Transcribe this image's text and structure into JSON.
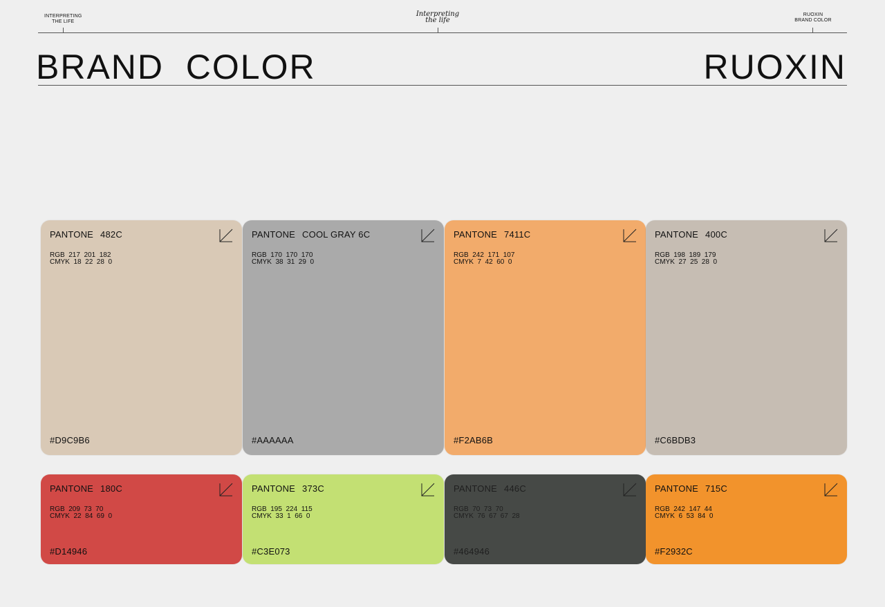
{
  "header": {
    "left_line1": "INTERPRETING",
    "left_line2": "THE LIFE",
    "center_line1": "Interpreting",
    "center_line2": "the life",
    "right_line1": "RUOXIN",
    "right_line2": "BRAND COLOR"
  },
  "title": {
    "left": "BRAND  COLOR",
    "right": "RUOXIN"
  },
  "swatches": [
    {
      "label": "PANTONE",
      "code": "482C",
      "rgb": "RGB  217  201  182",
      "cmyk": "CMYK  18  22  28  0",
      "hex": "#D9C9B6",
      "color": "#D9C9B6"
    },
    {
      "label": "PANTONE",
      "code": "COOL GRAY 6C",
      "rgb": "RGB  170  170  170",
      "cmyk": "CMYK  38  31  29  0",
      "hex": "#AAAAAA",
      "color": "#AAAAAA"
    },
    {
      "label": "PANTONE",
      "code": "7411C",
      "rgb": "RGB  242  171  107",
      "cmyk": "CMYK  7  42  60  0",
      "hex": "#F2AB6B",
      "color": "#F2AB6B"
    },
    {
      "label": "PANTONE",
      "code": "400C",
      "rgb": "RGB  198  189  179",
      "cmyk": "CMYK  27  25  28  0",
      "hex": "#C6BDB3",
      "color": "#C6BDB3"
    },
    {
      "label": "PANTONE",
      "code": "180C",
      "rgb": "RGB  209  73  70",
      "cmyk": "CMYK  22  84  69  0",
      "hex": "#D14946",
      "color": "#D14946"
    },
    {
      "label": "PANTONE",
      "code": "373C",
      "rgb": "RGB  195  224  115",
      "cmyk": "CMYK  33  1  66  0",
      "hex": "#C3E073",
      "color": "#C3E073"
    },
    {
      "label": "PANTONE",
      "code": "446C",
      "rgb": "RGB  70  73  70",
      "cmyk": "CMYK  76  67  67  28",
      "hex": "#464946",
      "color": "#464946"
    },
    {
      "label": "PANTONE",
      "code": "715C",
      "rgb": "RGB  242  147  44",
      "cmyk": "CMYK  6  53  84  0",
      "hex": "#F2932C",
      "color": "#F2932C"
    }
  ]
}
